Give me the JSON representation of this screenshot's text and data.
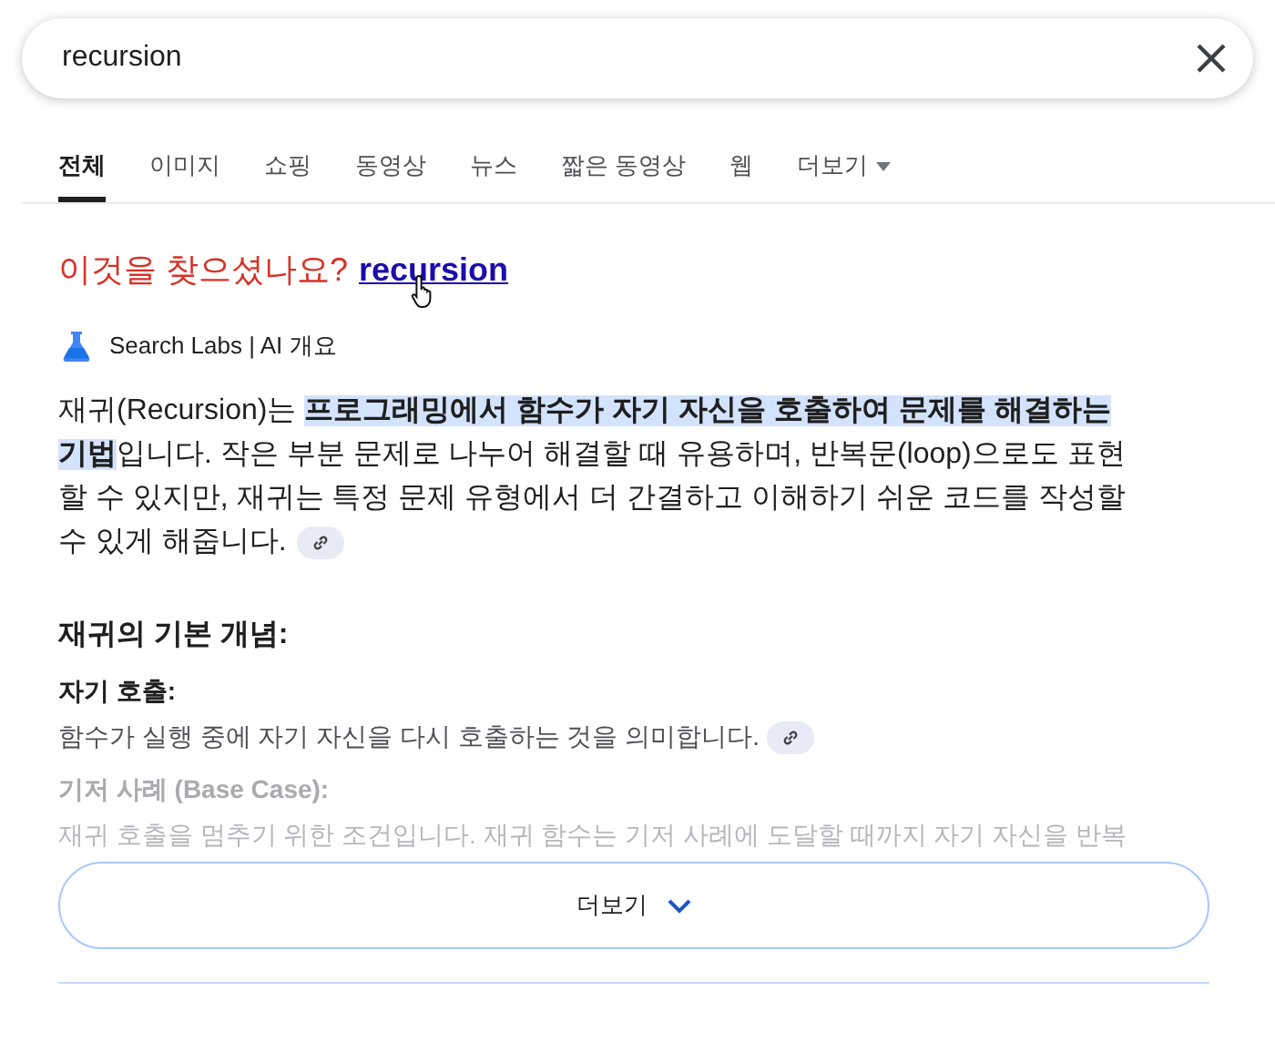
{
  "search": {
    "value": "recursion"
  },
  "tabs": [
    {
      "label": "전체",
      "selected": true,
      "kind": "tab"
    },
    {
      "label": "이미지",
      "selected": false,
      "kind": "tab"
    },
    {
      "label": "쇼핑",
      "selected": false,
      "kind": "tab"
    },
    {
      "label": "동영상",
      "selected": false,
      "kind": "tab"
    },
    {
      "label": "뉴스",
      "selected": false,
      "kind": "tab"
    },
    {
      "label": "짧은 동영상",
      "selected": false,
      "kind": "tab"
    },
    {
      "label": "웹",
      "selected": false,
      "kind": "tab"
    },
    {
      "label": "더보기",
      "selected": false,
      "kind": "menu"
    }
  ],
  "did_you_mean": {
    "prompt": "이것을 찾으셨나요?",
    "suggestion": "recursion"
  },
  "ai_overview": {
    "source": "Search Labs | AI 개요",
    "summary": "재귀(Recursion)는 **프로그래밍에서 함수가 자기 자신을 호출하여 문제를 해결하는 기법**입니다. 작은 부분 문제로 나누어 해결할 때 유용하며, 반복문(loop)으로도 표현할 수 있지만, 재귀는 특정 문제 유형에서 더 간결하고 이해하기 쉬운 코드를 작성할 수 있게 해줍니다.",
    "heading": "재귀의 기본 개념:",
    "items": [
      {
        "term": "자기 호출:",
        "description": "함수가 실행 중에 자기 자신을 다시 호출하는 것을 의미합니다.",
        "faded": false
      },
      {
        "term": "기저 사례 (Base Case):",
        "description": "재귀 호출을 멈추기 위한 조건입니다. 재귀 함수는 기저 사례에 도달할 때까지 자기 자신을 반복",
        "faded": true
      }
    ]
  },
  "more_button": {
    "label": "더보기"
  }
}
